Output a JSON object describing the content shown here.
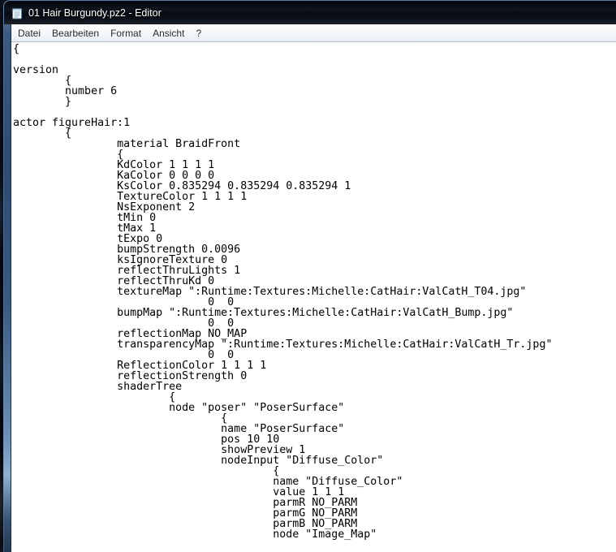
{
  "window": {
    "title": "01 Hair Burgundy.pz2 - Editor",
    "app_name": "Editor",
    "document_name": "01 Hair Burgundy.pz2",
    "icon": "notepad-icon"
  },
  "menu": {
    "items": [
      "Datei",
      "Bearbeiten",
      "Format",
      "Ansicht",
      "?"
    ]
  },
  "editor": {
    "lines": [
      "{",
      "",
      "version",
      "        {",
      "        number 6",
      "        }",
      "",
      "actor figureHair:1",
      "        {",
      "                material BraidFront",
      "                {",
      "                KdColor 1 1 1 1",
      "                KaColor 0 0 0 0",
      "                KsColor 0.835294 0.835294 0.835294 1",
      "                TextureColor 1 1 1 1",
      "                NsExponent 2",
      "                tMin 0",
      "                tMax 1",
      "                tExpo 0",
      "                bumpStrength 0.0096",
      "                ksIgnoreTexture 0",
      "                reflectThruLights 1",
      "                reflectThruKd 0",
      "                textureMap \":Runtime:Textures:Michelle:CatHair:ValCatH_T04.jpg\"",
      "                              0  0",
      "                bumpMap \":Runtime:Textures:Michelle:CatHair:ValCatH_Bump.jpg\"",
      "                              0  0",
      "                reflectionMap NO_MAP",
      "                transparencyMap \":Runtime:Textures:Michelle:CatHair:ValCatH_Tr.jpg\"",
      "                              0  0",
      "                ReflectionColor 1 1 1 1",
      "                reflectionStrength 0",
      "                shaderTree",
      "                        {",
      "                        node \"poser\" \"PoserSurface\"",
      "                                {",
      "                                name \"PoserSurface\"",
      "                                pos 10 10",
      "                                showPreview 1",
      "                                nodeInput \"Diffuse_Color\"",
      "                                        {",
      "                                        name \"Diffuse_Color\"",
      "                                        value 1 1 1",
      "                                        parmR NO_PARM",
      "                                        parmG NO_PARM",
      "                                        parmB NO_PARM",
      "                                        node \"Image_Map\""
    ]
  },
  "colors": {
    "titlebar_bg": "#0b1119",
    "glass_border": "#3a5a82",
    "menubar_border": "#a9c0d6",
    "client_bg": "#ffffff",
    "text": "#000000",
    "title_text": "#ffffff"
  }
}
